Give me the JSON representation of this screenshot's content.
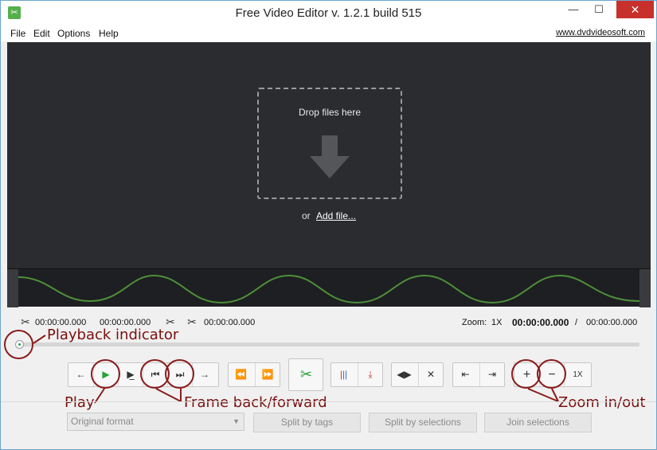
{
  "window": {
    "title": "Free Video Editor v. 1.2.1 build 515"
  },
  "menu": {
    "file": "File",
    "edit": "Edit",
    "options": "Options",
    "help": "Help",
    "site": "www.dvdvideosoft.com"
  },
  "preview": {
    "drop_text": "Drop files here",
    "or_text": "or",
    "add_file": "Add file..."
  },
  "timeline": {
    "start_time": "00:00:00.000",
    "end_time": "00:00:00.000",
    "cut_time": "00:00:00.000",
    "zoom_label": "Zoom:",
    "zoom_value": "1X",
    "current_time": "00:00:00.000",
    "separator": "/",
    "total_time": "00:00:00.000"
  },
  "controls": {
    "zoom_reset": "1X"
  },
  "annotations": {
    "playback": "Playback indicator",
    "play": "Play",
    "frame": "Frame back/forward",
    "zoom": "Zoom in/out"
  },
  "bottom": {
    "format": "Original format",
    "split_tags": "Split by tags",
    "split_selections": "Split by selections",
    "join": "Join selections"
  },
  "colors": {
    "accent_green": "#27a23b",
    "annotation_red": "#8b1c1c",
    "preview_bg": "#2b2c2f",
    "wave_green": "#4e8f3a"
  }
}
